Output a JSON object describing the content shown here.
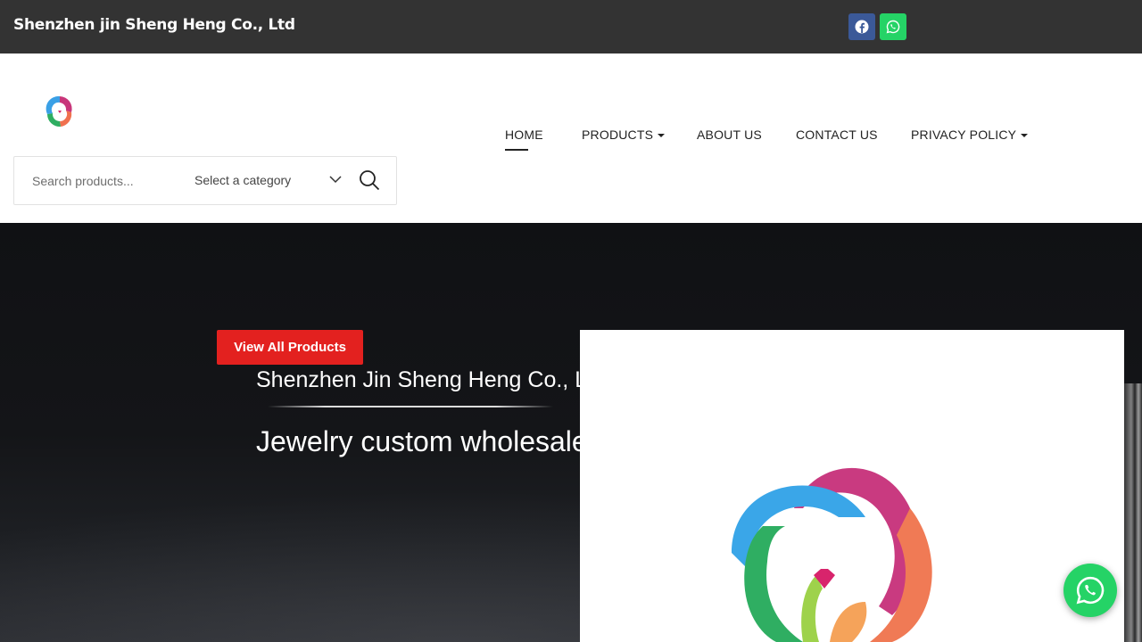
{
  "topbar": {
    "site_title": "Shenzhen jin Sheng Heng Co., Ltd",
    "social": [
      "facebook-icon",
      "whatsapp-icon"
    ]
  },
  "search": {
    "placeholder": "Search products...",
    "category_label": "Select a category"
  },
  "nav": {
    "home": "HOME",
    "products": "PRODUCTS",
    "about": "ABOUT US",
    "contact": "CONTACT US",
    "privacy": "PRIVACY POLICY"
  },
  "hero": {
    "cta": "View All Products",
    "company": "Shenzhen Jin Sheng Heng Co., Ltd",
    "tagline": "Jewelry custom wholesale"
  },
  "colors": {
    "topbar_bg": "#333333",
    "accent_red": "#e3211f",
    "facebook": "#3b5998",
    "whatsapp": "#25d366"
  }
}
